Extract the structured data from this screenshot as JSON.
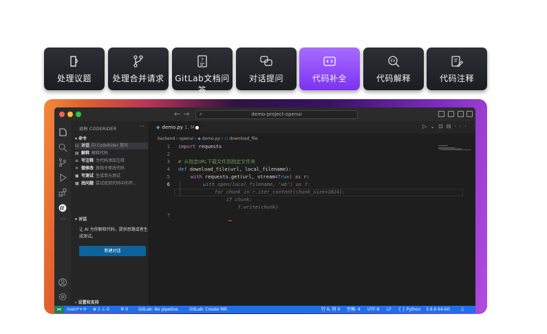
{
  "feature_tabs": [
    {
      "label": "处理议题",
      "icon": "document-icon",
      "active": false
    },
    {
      "label": "处理合并请求",
      "icon": "merge-icon",
      "active": false
    },
    {
      "label": "GitLab文档问答",
      "icon": "docs-question-icon",
      "active": false
    },
    {
      "label": "对话提问",
      "icon": "chat-bubbles-icon",
      "active": false
    },
    {
      "label": "代码补全",
      "icon": "code-brackets-icon",
      "active": true
    },
    {
      "label": "代码解释",
      "icon": "code-search-icon",
      "active": false
    },
    {
      "label": "代码注释",
      "icon": "code-edit-icon",
      "active": false
    }
  ],
  "window": {
    "command_center": "demo-project-openui",
    "accent": "#7c32f0"
  },
  "sidebar": {
    "title": "运码 CODERIDER",
    "commands_section": "命令",
    "commands": [
      {
        "name": "对话",
        "desc": "向 CodeRider 提问"
      },
      {
        "name": "解释",
        "desc": "解释代码"
      },
      {
        "name": "写注释",
        "desc": "为代码添加注释"
      },
      {
        "name": "做修改",
        "desc": "按指令修改代码"
      },
      {
        "name": "写测试",
        "desc": "生成单元测试"
      },
      {
        "name": "找问题",
        "desc": "尝试找到代码中的坏..."
      }
    ],
    "chat_section": "对话",
    "chat_prompt": "让 AI 为你解释代码，提供思路或者生成测试。",
    "new_chat_button": "新建对话",
    "settings_section": "设置和支持"
  },
  "editor": {
    "tab_label": "demo.py",
    "tab_modified": "1, M",
    "breadcrumb": [
      "backend",
      "openui",
      "demo.py",
      "download_file"
    ],
    "line_numbers": [
      "1",
      "2",
      "3",
      "4",
      "5",
      "6",
      "7"
    ],
    "code": {
      "l1_kw": "import",
      "l1_mod": " requests",
      "l3_comment": "# 从指定URL下载文件到指定文件夹",
      "l4_def": "def",
      "l4_fn": " download_file",
      "l4_args": "(url, local_filename):",
      "l5_with": "with",
      "l5_call": " requests.",
      "l5_get": "get",
      "l5_args": "(url, stream=",
      "l5_true": "True",
      "l5_as": ") as",
      "l5_var": " r:"
    },
    "completion": [
      "with open(local_filename, 'wb') as f:",
      "    for chunk in r.iter_content(chunk_size=1024):",
      "        if chunk:",
      "            f.write(chunk)"
    ]
  },
  "statusbar": {
    "branch": "main*+",
    "sync": "⟳",
    "problems": "⊗ 1 ⚠ 0",
    "ports": "♅ 0",
    "pipeline": "GitLab: No pipeline.",
    "create_mr": "GitLab: Create MR.",
    "position": "行 6, 列 9",
    "spaces": "空格: 4",
    "encoding": "UTF-8",
    "eol": "LF",
    "language": "Python",
    "interpreter": "3.9.6 64-bit"
  }
}
